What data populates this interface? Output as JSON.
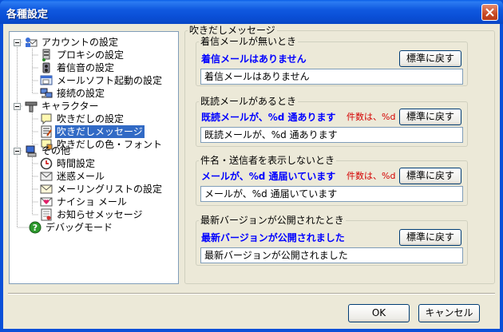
{
  "window": {
    "title": "各種設定"
  },
  "tree": {
    "items": [
      {
        "label": "アカウントの設定",
        "icon": "mail-account-icon"
      },
      {
        "label": "プロキシの設定",
        "icon": "proxy-server-icon"
      },
      {
        "label": "着信音の設定",
        "icon": "speaker-icon"
      },
      {
        "label": "メールソフト起動の設定",
        "icon": "mail-launch-icon"
      },
      {
        "label": "接続の設定",
        "icon": "network-icon"
      },
      {
        "label": "キャラクター",
        "icon": "character-icon"
      },
      {
        "label": "吹きだしの設定",
        "icon": "balloon-icon"
      },
      {
        "label": "吹きだしメッセージ",
        "icon": "balloon-message-icon"
      },
      {
        "label": "吹きだしの色・フォント",
        "icon": "balloon-font-icon"
      },
      {
        "label": "その他",
        "icon": "misc-computer-icon"
      },
      {
        "label": "時間設定",
        "icon": "clock-icon"
      },
      {
        "label": "迷惑メール",
        "icon": "spam-mail-icon"
      },
      {
        "label": "メーリングリストの設定",
        "icon": "mailing-list-icon"
      },
      {
        "label": "ナイショ メール",
        "icon": "secret-mail-icon"
      },
      {
        "label": "お知らせメッセージ",
        "icon": "notice-icon"
      },
      {
        "label": "デバッグモード",
        "icon": "help-icon"
      }
    ],
    "selected": "吹きだしメッセージ"
  },
  "panel": {
    "title": "吹きだしメッセージ",
    "groups": [
      {
        "label": "着信メールが無いとき",
        "preview": "着信メールはありません",
        "count": "",
        "reset_label": "標準に戻す",
        "value": "着信メールはありません"
      },
      {
        "label": "既読メールがあるとき",
        "preview": "既読メールが、%d 通あります",
        "count": "件数は、%d",
        "reset_label": "標準に戻す",
        "value": "既読メールが、%d 通あります"
      },
      {
        "label": "件名・送信者を表示しないとき",
        "preview": "メールが、%d 通届いています",
        "count": "件数は、%d",
        "reset_label": "標準に戻す",
        "value": "メールが、%d 通届いています"
      },
      {
        "label": "最新バージョンが公開されたとき",
        "preview": "最新バージョンが公開されました",
        "count": "",
        "reset_label": "標準に戻す",
        "value": "最新バージョンが公開されました"
      }
    ]
  },
  "buttons": {
    "ok": "OK",
    "cancel": "キャンセル"
  },
  "colors": {
    "preview_text": "#0000ff",
    "count_text": "#d40000",
    "selection": "#316ac5",
    "titlebar": "#0a50d8"
  }
}
